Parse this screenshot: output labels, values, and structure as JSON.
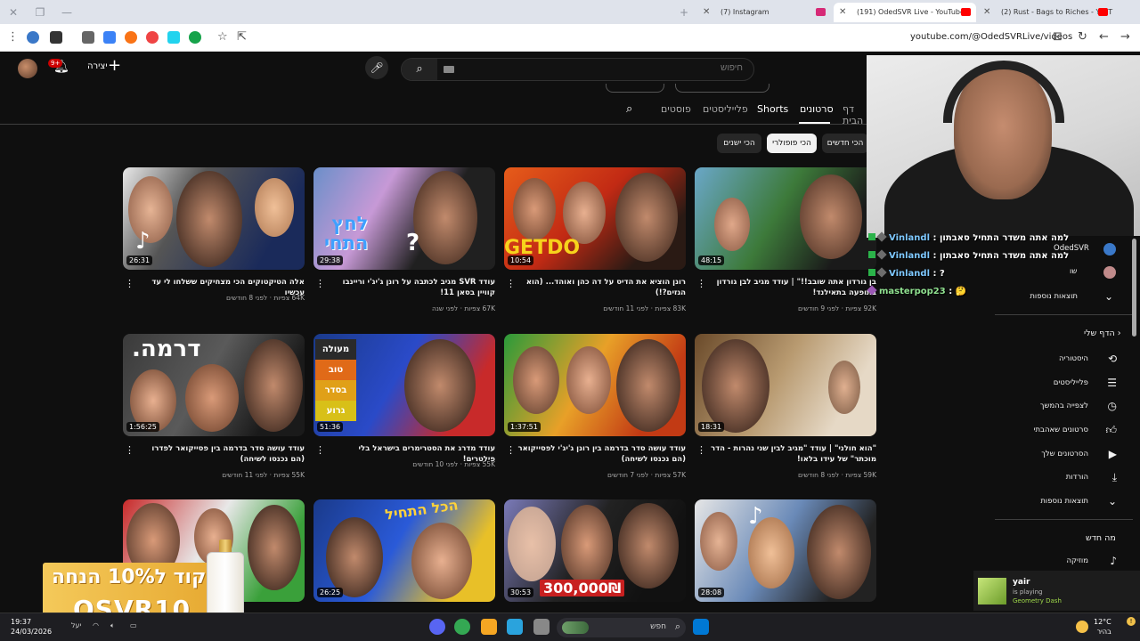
{
  "browser": {
    "tabs": [
      {
        "label": "(7) Instagram",
        "favicon_color": "#d62976",
        "active": false
      },
      {
        "label": "(191) OdedSVR Live - YouTube",
        "favicon_color": "#ff0000",
        "active": true
      },
      {
        "label": "(2) Rust - Bags to Riches - YouT",
        "favicon_color": "#ff0000",
        "active": false
      }
    ],
    "url": "youtube.com/@OdedSVRLive/videos",
    "new_tab": "+"
  },
  "header": {
    "search_placeholder": "חיפוש",
    "create_label": "יצירה",
    "notification_count": "9+"
  },
  "channel_tabs": {
    "items": [
      "דף הבית",
      "סרטונים",
      "Shorts",
      "פלייליסטים",
      "פוסטים"
    ],
    "active": "סרטונים"
  },
  "chips": [
    {
      "label": "הכי חדשים",
      "active": false
    },
    {
      "label": "הכי פופולרי",
      "active": true
    },
    {
      "label": "הכי ישנים",
      "active": false
    }
  ],
  "videos": [
    {
      "title": "בן גורדון אתה שובב!!\" | עודד מגיב לבן גורדון בתופעה בתאילנד!",
      "views": "92K צפיות",
      "age": "לפני 9 חודשים",
      "duration": "48:15"
    },
    {
      "title": "רונן הוציא את הדיס על דה כהן ואוהד... (הוא הגזים?!)",
      "views": "83K צפיות",
      "age": "לפני 11 חודשים",
      "duration": "10:54"
    },
    {
      "title": "עודד SVR מגיב לכתבה על רונן ג'יג'י וריינבו קוויין בסאן 11!",
      "views": "67K צפיות",
      "age": "לפני שנה",
      "duration": "29:38"
    },
    {
      "title": "אלה הטיקטוקים הכי מצחיקים ששלחו לי עד עכשיו",
      "views": "64K צפיות",
      "age": "לפני 8 חודשים",
      "duration": "26:31"
    },
    {
      "title": "\"הוא חולני\" | עודד \"מגיב לבין שני נהרות - הדר מוכתר\" של עידו בלאו!",
      "views": "59K צפיות",
      "age": "לפני 8 חודשים",
      "duration": "18:31"
    },
    {
      "title": "עודד עושה סדר בדרמה בין רונן ג'יג'י לפסייקואר (הם נכנסו לשיחה)",
      "views": "57K צפיות",
      "age": "לפני 7 חודשים",
      "duration": "1:37:51"
    },
    {
      "title": "עודד מדרג את הסטרימרים בישראל בלי פילטרים!",
      "views": "55K צפיות",
      "age": "לפני 10 חודשים",
      "duration": "51:36"
    },
    {
      "title": "עודד עושה סדר בדרמה בין פסייקואר לפדרו (הם נכנסו לשיחה)",
      "views": "55K צפיות",
      "age": "לפני 11 חודשים",
      "duration": "1:56:25"
    },
    {
      "title": "",
      "views": "",
      "age": "",
      "duration": "28:08"
    },
    {
      "title": "",
      "views": "",
      "age": "",
      "duration": "30:53"
    },
    {
      "title": "",
      "views": "",
      "age": "",
      "duration": "26:25"
    },
    {
      "title": "",
      "views": "",
      "age": "",
      "duration": ""
    }
  ],
  "thumb_texts": {
    "t2": "GETDO",
    "t3a": "לחץ",
    "t3b": "התחי",
    "t8": "דרמה.",
    "t7_list": [
      "מעולה",
      "טוב",
      "בסדר",
      "גרוע"
    ],
    "t11": "300,000₪",
    "t10": "הכל התחיל"
  },
  "chat": [
    {
      "user": "Vinlandl",
      "message": "למה אתה משדר התחיל סאבתון"
    },
    {
      "user": "Vinlandl",
      "message": "למה אתה משדר התחיל סאבתון"
    },
    {
      "user": "Vinlandl",
      "message": "?"
    },
    {
      "user": "masterpop23",
      "message": "🤔"
    }
  ],
  "side_panel": {
    "subscriptions": [
      {
        "name": "OdedSVR"
      },
      {
        "name": "שו"
      }
    ],
    "show_more": "תוצאות נוספות",
    "you_header": "הדף שלי",
    "you_items": [
      {
        "label": "היסטוריה",
        "icon": "history-icon"
      },
      {
        "label": "פלייליסטים",
        "icon": "playlist-icon"
      },
      {
        "label": "לצפייה בהמשך",
        "icon": "clock-icon"
      },
      {
        "label": "סרטונים שאהבתי",
        "icon": "thumbs-up-icon"
      },
      {
        "label": "הסרטונים שלך",
        "icon": "video-icon"
      },
      {
        "label": "הורדות",
        "icon": "download-icon"
      },
      {
        "label": "תוצאות נוספות",
        "icon": "chevron-down-icon"
      }
    ],
    "explore_header": "מה חדש",
    "explore_items": [
      {
        "label": "מוזיקה",
        "icon": "music-icon"
      }
    ]
  },
  "now_playing": {
    "user": "yair",
    "status": "is playing",
    "game": "Geometry Dash"
  },
  "promo": {
    "line1": "קוד ל10% הנחה",
    "line2": "OSVR10"
  },
  "taskbar": {
    "time": "19:37",
    "date": "24/03/2026",
    "search_label": "חפש",
    "weather_temp": "12°C",
    "weather_desc": "בהיר",
    "misc": "יעל"
  }
}
